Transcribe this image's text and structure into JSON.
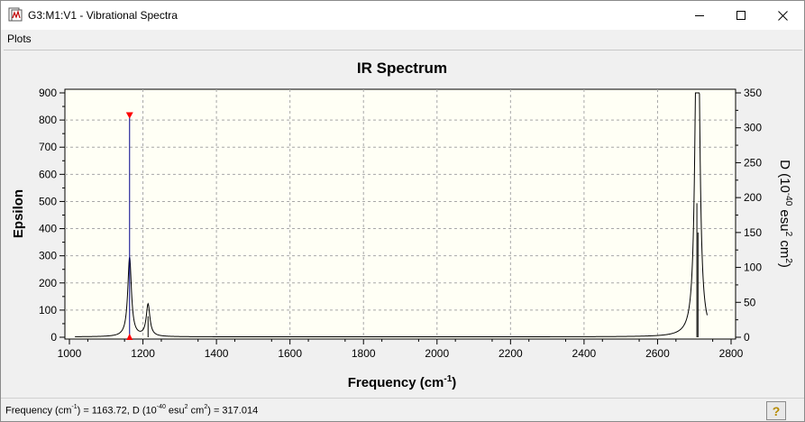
{
  "window": {
    "title": "G3:M1:V1 - Vibrational Spectra"
  },
  "menu": {
    "items": [
      "Plots"
    ]
  },
  "chart_data": {
    "type": "line",
    "title": "IR Spectrum",
    "xlabel": "Frequency (cm-1)",
    "ylabel": "Epsilon",
    "y2label": "D (10-40 esu2 cm2)",
    "xlim": [
      1000,
      2800
    ],
    "ylim": [
      0,
      900
    ],
    "y2lim": [
      0,
      350
    ],
    "x_ticks": [
      "1000",
      "1200",
      "1400",
      "1600",
      "1800",
      "2000",
      "2200",
      "2400",
      "2600",
      "2800"
    ],
    "y_ticks": [
      "0",
      "100",
      "200",
      "300",
      "400",
      "500",
      "600",
      "700",
      "800",
      "900"
    ],
    "y2_ticks": [
      "0",
      "50",
      "100",
      "150",
      "200",
      "250",
      "300",
      "350"
    ],
    "grid": true,
    "background_color": "#fffff5",
    "line_color": "#000000",
    "stick_color": "#00008b",
    "marker_color": "#ff0000",
    "peaks": [
      {
        "frequency": 1163.72,
        "epsilon": 292,
        "intensity_D": 317.014
      },
      {
        "frequency": 1214,
        "epsilon": 118,
        "intensity_D": 30
      },
      {
        "frequency": 2707,
        "epsilon": 870,
        "intensity_D": 192
      },
      {
        "frequency": 2710,
        "epsilon": 760,
        "intensity_D": 150
      }
    ],
    "selected_peak": {
      "frequency": 1163.72,
      "intensity_D": 317.014
    }
  },
  "status": {
    "freq_label": "Frequency (cm",
    "freq_sup": "-1",
    "middle": ") = 1163.72, D (10",
    "exp_sup": "-40",
    "esu": " esu",
    "esu_sup": "2",
    "cm": " cm",
    "cm_sup": "2",
    "value": ") = 317.014"
  },
  "icons": {
    "app": "spectra-app-icon",
    "help": "help-icon"
  }
}
